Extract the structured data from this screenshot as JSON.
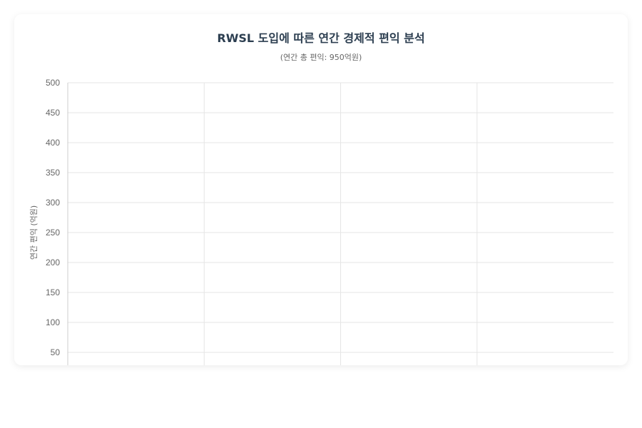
{
  "chart_data": {
    "type": "bar",
    "title": "RWSL 도입에 따른 연간 경제적 편익 분석",
    "subtitle": "(연간 총 편익: 950억원)",
    "xlabel": "",
    "ylabel": "연간 편익 (억원)",
    "ylim": [
      0,
      500
    ],
    "yticks": [
      500,
      450,
      400,
      350,
      300,
      250,
      200,
      150,
      100,
      50
    ],
    "categories": [
      "",
      "",
      "",
      ""
    ],
    "grid": true,
    "colors": {
      "title": "#2c3e50",
      "text": "#666666",
      "grid": "#e5e5e5",
      "axis": "#cccccc"
    }
  }
}
